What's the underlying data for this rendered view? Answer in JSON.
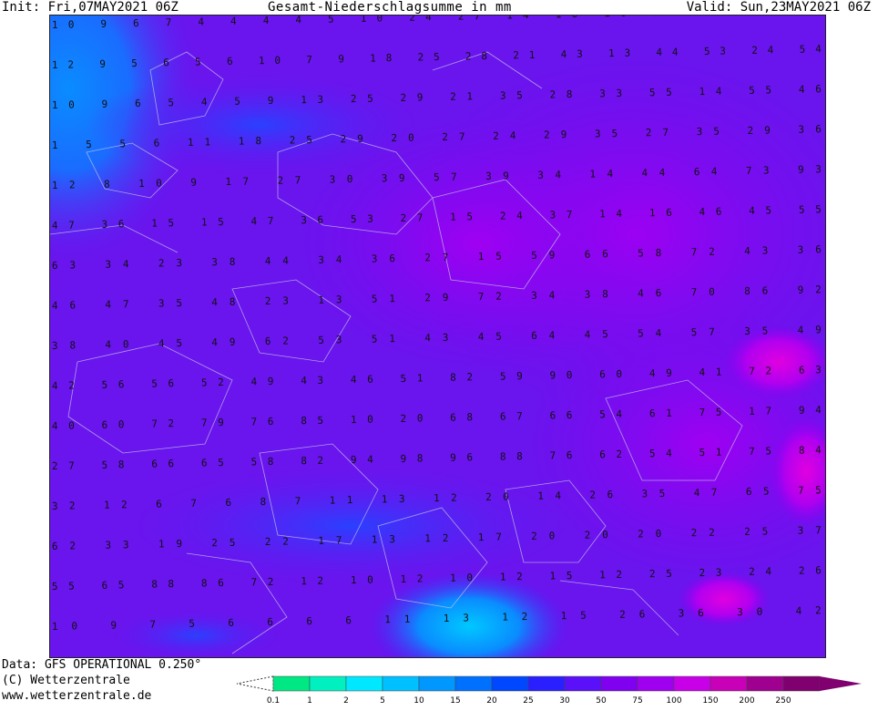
{
  "header": {
    "init": "Init: Fri,07MAY2021 06Z",
    "title": "Gesamt-Niederschlagsumme in mm",
    "valid": "Valid: Sun,23MAY2021 06Z"
  },
  "footer": {
    "data_source": "Data: GFS OPERATIONAL 0.250°",
    "copyright": "(C) Wetterzentrale",
    "url": "www.wetterzentrale.de"
  },
  "legend": {
    "unit": "mm",
    "labels": [
      "0.1",
      "1",
      "2",
      "5",
      "10",
      "15",
      "20",
      "25",
      "30",
      "50",
      "75",
      "100",
      "150",
      "200",
      "250"
    ],
    "colors": [
      "#00e884",
      "#00f0c0",
      "#00e8ff",
      "#00c0ff",
      "#0098ff",
      "#0070ff",
      "#0048ff",
      "#2a20ff",
      "#5a10f8",
      "#8000f0",
      "#a000f0",
      "#c800e8",
      "#c800b8",
      "#a00090",
      "#800070"
    ]
  },
  "map": {
    "background_color": "#6a14ee",
    "sample_value_rows": [
      "10 9 6 7 4 4 4 4 5 10 24 27 14 16 16 17 14 15 21",
      "12 9 5 6 5 6 10 7 9 18 25 28 21 43 13 44 53 24 54",
      "10 9 6 5 4 5 9 13 25 29 21 35 28 33 55 14 55 46",
      "1 5 5 6 11 18 25 29 20 27 24 29 35 27 35 29 36",
      "12 8 10 9 17 27 30 39 57 39 34 14 44 64 73 93",
      "47 36 15 15 47 36 53 27 15 24 37 14 16 46 45 55",
      "63 34 23 38 44 34 36 27 15 59 66 58 72 43 36",
      "46 47 35 48 23 13 51 29 72 34 38 46 70 86 92",
      "38 40 45 49 62 53 51 43 45 64 45 54 57 35 49",
      "42 56 56 52 49 43 46 51 82 59 90 60 49 41 72 63",
      "40 60 72 79 76 85 10 20 68 67 66 54 61 75 17 94",
      "27 58 66 65 58 82 94 98 96 88 76 62 54 51 75 84",
      "32 12 6 7 6 8 7 11 13 12 20 14 26 35 47 65 75",
      "62 33 19 25 22 17 13 12 17 20 20 20 22 25 37",
      "55 65 88 86 72 12 10 12 10 12 15 12 25 23 24 26",
      "10 9 7 5 6 6 6 6 11 13 12 15 26 36 30 42"
    ]
  }
}
